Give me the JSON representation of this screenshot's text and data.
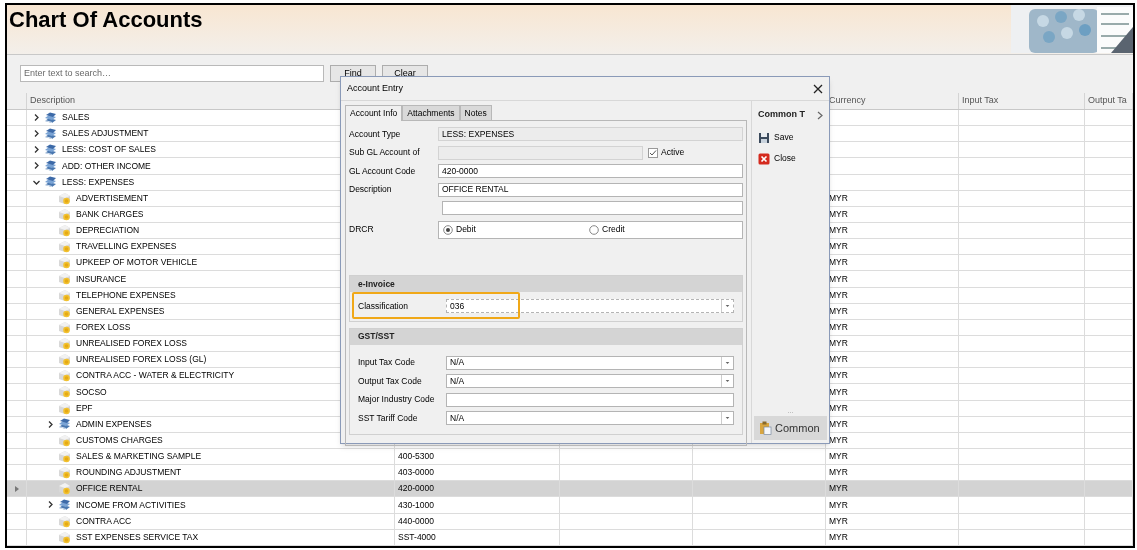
{
  "header": {
    "title": "Chart Of Accounts"
  },
  "toolbar": {
    "search": {
      "placeholder": "Enter text to search…"
    },
    "buttons": [
      "Find",
      "Clear"
    ]
  },
  "grid": {
    "columns": [
      "Description",
      "Currency",
      "Input Tax",
      "Output Ta"
    ],
    "rows": [
      {
        "label": "SALES",
        "kind": "group",
        "expanded": false,
        "selected": false
      },
      {
        "label": "SALES ADJUSTMENT",
        "kind": "group",
        "expanded": false,
        "selected": false
      },
      {
        "label": "LESS: COST OF SALES",
        "kind": "group",
        "expanded": false,
        "selected": false
      },
      {
        "label": "ADD: OTHER INCOME",
        "kind": "group",
        "expanded": false,
        "selected": false
      },
      {
        "label": "LESS: EXPENSES",
        "kind": "group",
        "expanded": true,
        "selected": false,
        "children": [
          {
            "label": "ADVERTISEMENT",
            "kind": "account",
            "currency": "MYR",
            "selected": false
          },
          {
            "label": "BANK CHARGES",
            "kind": "account",
            "currency": "MYR",
            "selected": false
          },
          {
            "label": "DEPRECIATION",
            "kind": "account",
            "currency": "MYR",
            "selected": false
          },
          {
            "label": "TRAVELLING EXPENSES",
            "kind": "account",
            "currency": "MYR",
            "selected": false
          },
          {
            "label": "UPKEEP OF MOTOR VEHICLE",
            "kind": "account",
            "currency": "MYR",
            "selected": false
          },
          {
            "label": "INSURANCE",
            "kind": "account",
            "currency": "MYR",
            "selected": false
          },
          {
            "label": "TELEPHONE EXPENSES",
            "kind": "account",
            "currency": "MYR",
            "selected": false
          },
          {
            "label": "GENERAL EXPENSES",
            "kind": "account",
            "currency": "MYR",
            "selected": false
          },
          {
            "label": "FOREX LOSS",
            "kind": "account",
            "currency": "MYR",
            "selected": false
          },
          {
            "label": "UNREALISED FOREX LOSS",
            "kind": "account",
            "currency": "MYR",
            "selected": false
          },
          {
            "label": "UNREALISED FOREX LOSS (GL)",
            "kind": "account",
            "currency": "MYR",
            "selected": false
          },
          {
            "label": "CONTRA ACC - WATER & ELECTRICITY",
            "kind": "account",
            "currency": "MYR",
            "selected": false
          },
          {
            "label": "SOCSO",
            "kind": "account",
            "currency": "MYR",
            "selected": false
          },
          {
            "label": "EPF",
            "kind": "account",
            "currency": "MYR",
            "selected": false
          },
          {
            "label": "ADMIN EXPENSES",
            "kind": "group",
            "expanded": false,
            "currency": "MYR",
            "selected": false
          },
          {
            "label": "CUSTOMS CHARGES",
            "kind": "account",
            "currency": "MYR",
            "selected": false
          },
          {
            "label": "SALES & MARKETING SAMPLE",
            "kind": "account",
            "code": "400-5300",
            "currency": "MYR",
            "selected": false
          },
          {
            "label": "ROUNDING ADJUSTMENT",
            "kind": "account",
            "code": "403-0000",
            "currency": "MYR",
            "selected": false
          },
          {
            "label": "OFFICE RENTAL",
            "kind": "account",
            "code": "420-0000",
            "currency": "MYR",
            "selected": true
          },
          {
            "label": "INCOME FROM ACTIVITIES",
            "kind": "group",
            "expanded": false,
            "code": "430-1000",
            "currency": "MYR",
            "selected": false
          },
          {
            "label": "CONTRA ACC",
            "kind": "account",
            "code": "440-0000",
            "currency": "MYR",
            "selected": false
          },
          {
            "label": "SST EXPENSES SERVICE TAX",
            "kind": "account",
            "code": "SST-4000",
            "currency": "MYR",
            "selected": false
          }
        ]
      }
    ]
  },
  "dialog": {
    "title": "Account Entry",
    "tabs": [
      {
        "label": "Account Info",
        "selected": true
      },
      {
        "label": "Attachments",
        "selected": false
      },
      {
        "label": "Notes",
        "selected": false
      }
    ],
    "fields": [
      {
        "label": "Account Type",
        "kind": "readonly",
        "value": "LESS: EXPENSES"
      },
      {
        "label": "Sub GL Account of",
        "kind": "disabled",
        "checkbox": {
          "label": "Active",
          "checked": true
        }
      },
      {
        "label": "GL Account Code",
        "kind": "text",
        "value": "420-0000"
      },
      {
        "label": "Description",
        "kind": "text",
        "value": "OFFICE RENTAL"
      },
      {
        "kind": "text"
      },
      {
        "label": "DRCR",
        "kind": "radio",
        "options": [
          {
            "label": "Debit",
            "selected": true
          },
          {
            "label": "Credit",
            "selected": false
          }
        ]
      }
    ],
    "sections": [
      {
        "title": "e-Invoice",
        "fields": [
          {
            "label": "Classification",
            "kind": "dropdown",
            "value": "036",
            "highlighted": true
          }
        ]
      },
      {
        "title": "GST/SST",
        "fields": [
          {
            "label": "Input Tax Code",
            "kind": "dropdown",
            "value": "N/A"
          },
          {
            "label": "Output Tax Code",
            "kind": "dropdown",
            "value": "N/A"
          },
          {
            "label": "Major Industry Code",
            "kind": "text"
          },
          {
            "label": "SST Tariff Code",
            "kind": "dropdown",
            "value": "N/A"
          }
        ]
      }
    ],
    "side_panel": {
      "title": "Common T",
      "actions": [
        {
          "label": "Save",
          "kind": "save"
        },
        {
          "label": "Close",
          "kind": "close"
        }
      ],
      "more": "...",
      "footer": "Common"
    }
  }
}
